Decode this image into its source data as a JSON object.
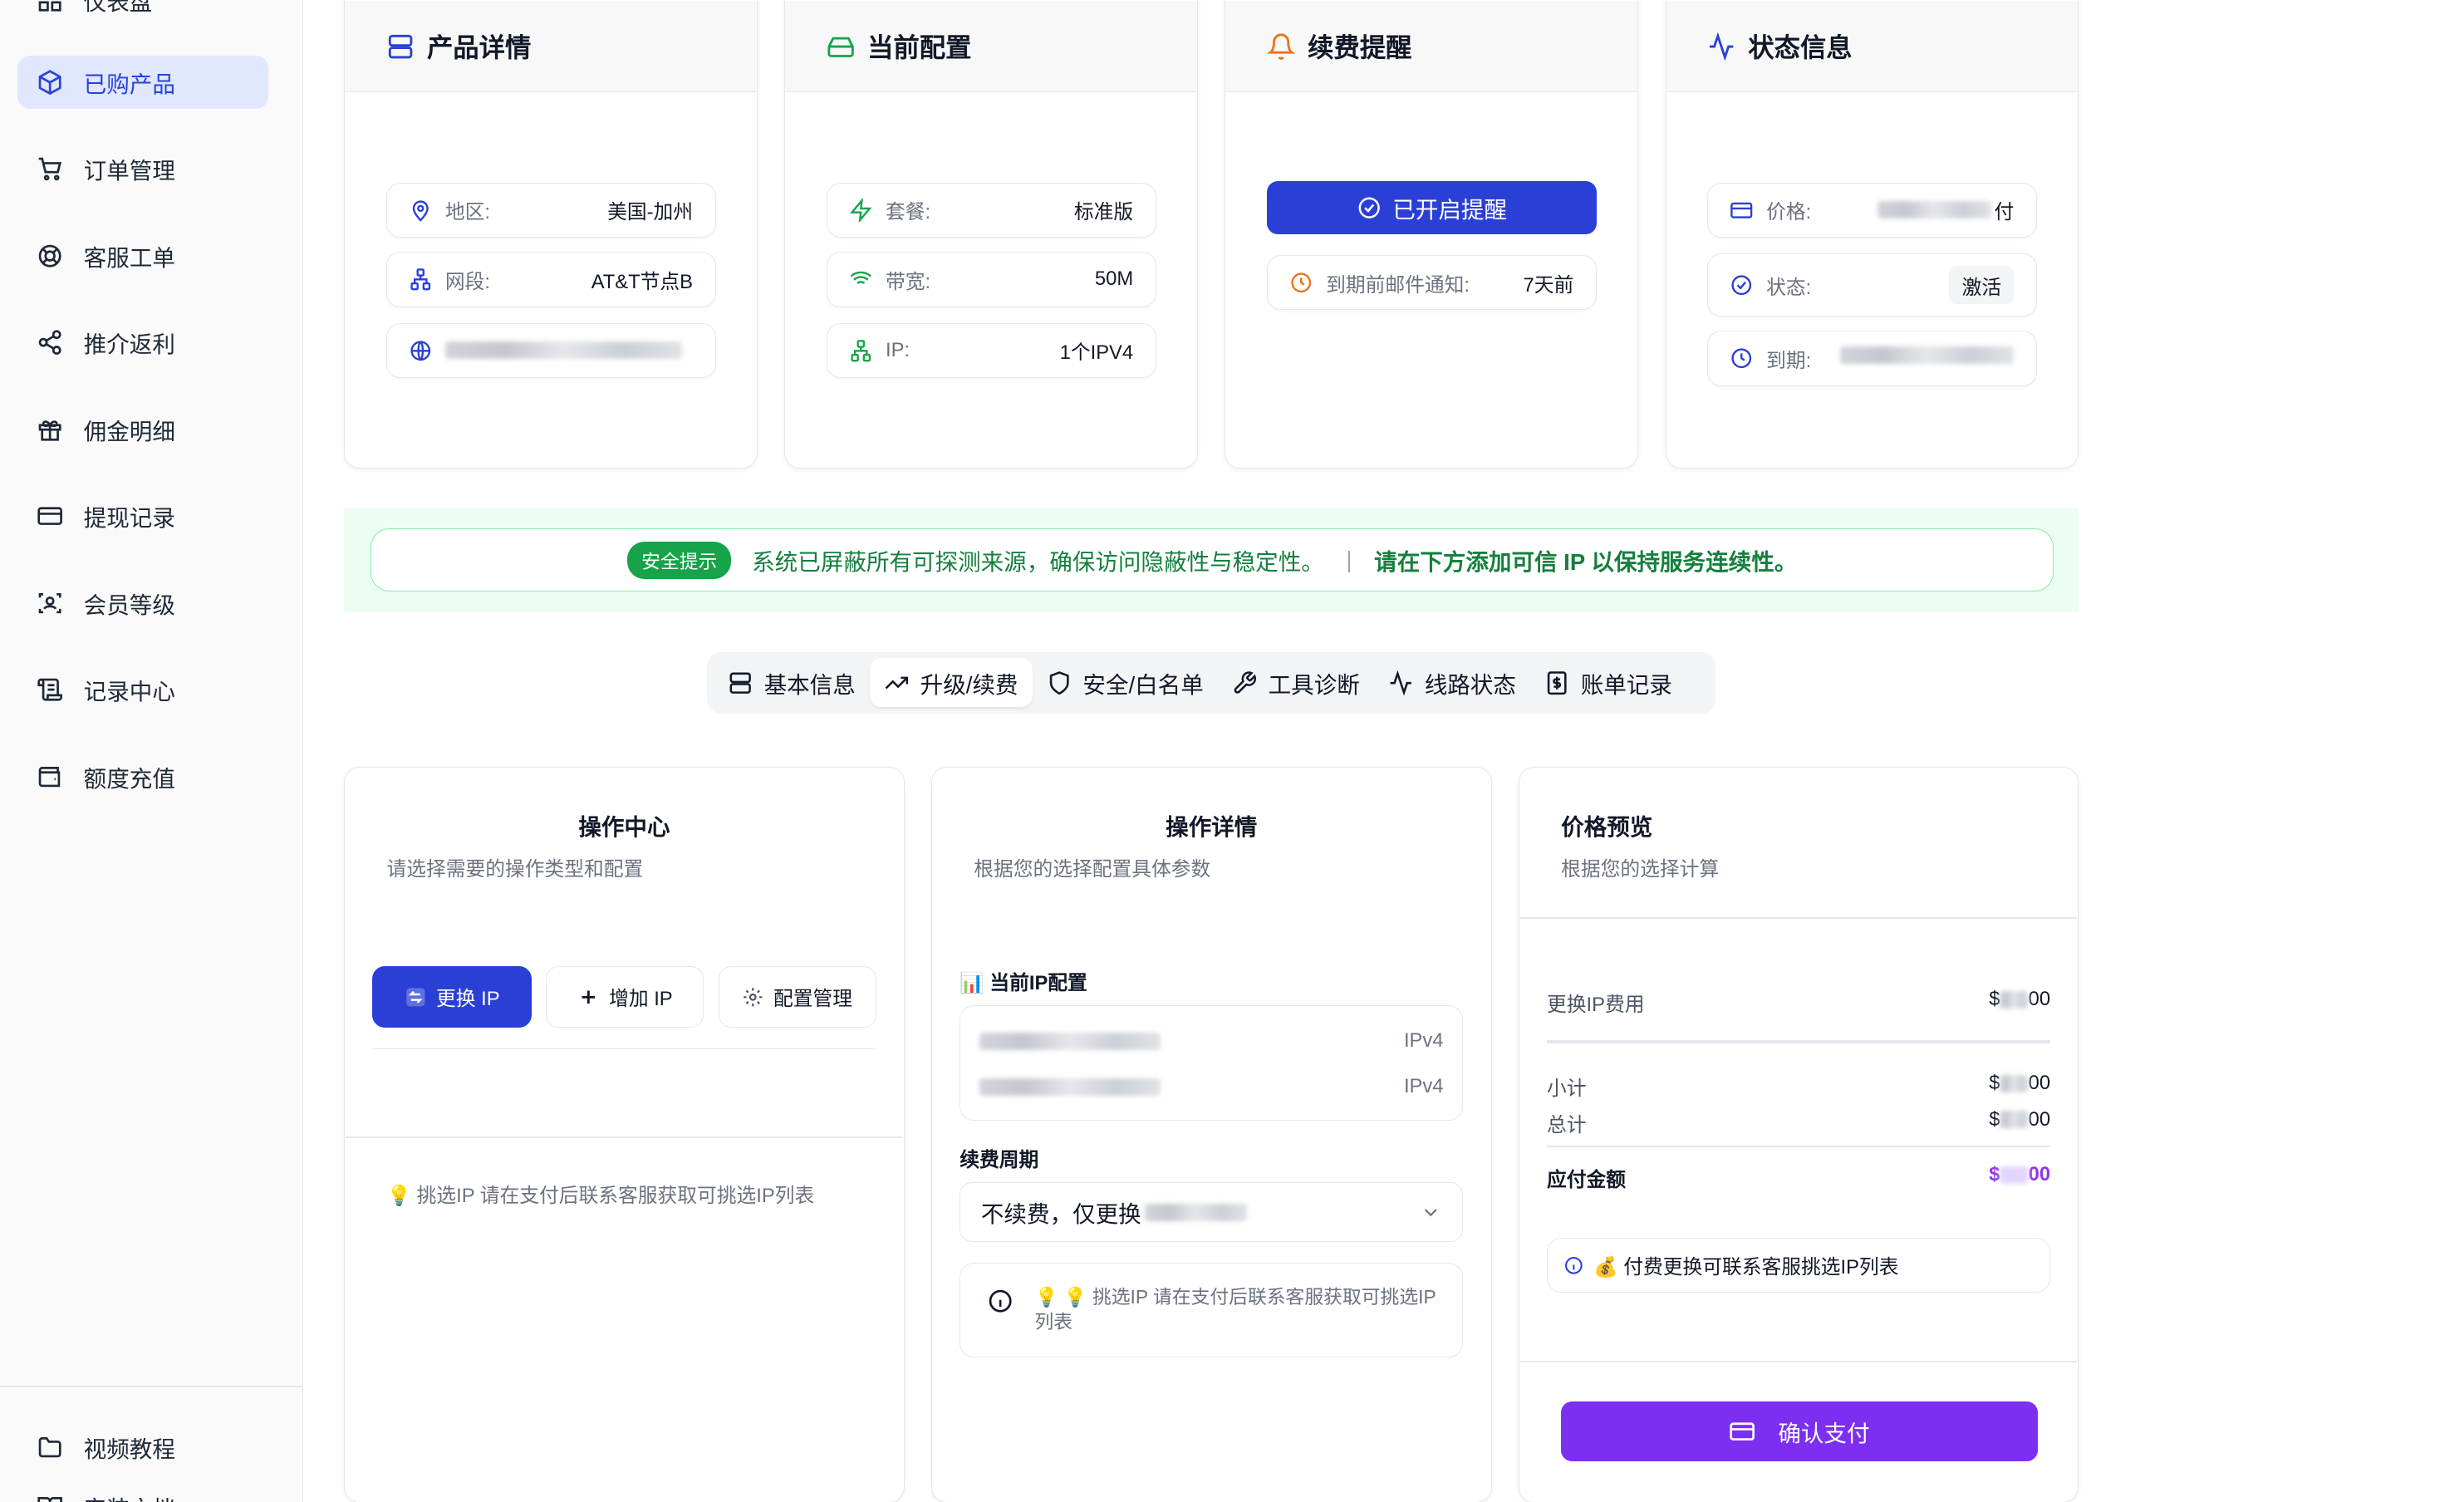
{
  "sidebar": {
    "items": [
      {
        "label": "仪表盘",
        "icon": "dashboard-icon"
      },
      {
        "label": "已购产品",
        "icon": "box-icon",
        "active": true
      },
      {
        "label": "订单管理",
        "icon": "cart-icon"
      },
      {
        "label": "客服工单",
        "icon": "lifebuoy-icon"
      },
      {
        "label": "推介返利",
        "icon": "share-icon"
      },
      {
        "label": "佣金明细",
        "icon": "gift-icon"
      },
      {
        "label": "提现记录",
        "icon": "card-icon"
      },
      {
        "label": "会员等级",
        "icon": "member-icon"
      },
      {
        "label": "记录中心",
        "icon": "scroll-icon"
      },
      {
        "label": "额度充值",
        "icon": "wallet-icon"
      }
    ],
    "footer": [
      {
        "label": "视频教程",
        "icon": "folder-icon"
      },
      {
        "label": "安装文档",
        "icon": "book-icon"
      }
    ]
  },
  "product_card": {
    "title": "产品详情",
    "region_label": "地区:",
    "region_value": "美国-加州",
    "segment_label": "网段:",
    "segment_value": "AT&T节点B"
  },
  "config_card": {
    "title": "当前配置",
    "plan_label": "套餐:",
    "plan_value": "标准版",
    "bandwidth_label": "带宽:",
    "bandwidth_value": "50M",
    "ip_label": "IP:",
    "ip_value": "1个IPV4"
  },
  "renew_card": {
    "title": "续费提醒",
    "button_label": "已开启提醒",
    "notice_label": "到期前邮件通知:",
    "notice_value": "7天前"
  },
  "status_card": {
    "title": "状态信息",
    "price_label": "价格:",
    "price_suffix": "付",
    "status_label": "状态:",
    "status_value": "激活",
    "expire_label": "到期:"
  },
  "banner": {
    "tag": "安全提示",
    "text": "系统已屏蔽所有可探测来源，确保访问隐蔽性与稳定性。",
    "separator": "|",
    "cta": "请在下方添加可信 IP 以保持服务连续性。"
  },
  "tabs": [
    {
      "label": "基本信息",
      "icon": "server-icon"
    },
    {
      "label": "升级/续费",
      "icon": "trending-up-icon",
      "active": true
    },
    {
      "label": "安全/白名单",
      "icon": "shield-icon"
    },
    {
      "label": "工具诊断",
      "icon": "wrench-icon"
    },
    {
      "label": "线路状态",
      "icon": "activity-icon"
    },
    {
      "label": "账单记录",
      "icon": "receipt-icon"
    }
  ],
  "operation_center": {
    "title": "操作中心",
    "subtitle": "请选择需要的操作类型和配置",
    "buttons": [
      "更换 IP",
      "增加 IP",
      "配置管理"
    ],
    "tip": "💡 挑选IP 请在支付后联系客服获取可挑选IP列表"
  },
  "operation_detail": {
    "title": "操作详情",
    "subtitle": "根据您的选择配置具体参数",
    "current_ip_label": "📊 当前IP配置",
    "ip_rows": [
      {
        "type": "IPv4"
      },
      {
        "type": "IPv4"
      }
    ],
    "period_label": "续费周期",
    "period_value": "不续费，仅更换",
    "info_text": "💡 💡 挑选IP 请在支付后联系客服获取可挑选IP列表"
  },
  "price_preview": {
    "title": "价格预览",
    "subtitle": "根据您的选择计算",
    "change_fee_label": "更换IP费用",
    "subtotal_label": "小计",
    "total_label": "总计",
    "payable_label": "应付金额",
    "amount_prefix": "$",
    "amount_suffix": "00",
    "note": "💰 付费更换可联系客服挑选IP列表",
    "confirm_label": "确认支付"
  },
  "colors": {
    "primary": "#2a3fd6",
    "purple": "#7c2ff0",
    "green": "#16a34a",
    "sidebar_active_bg": "#e0e7ff"
  }
}
